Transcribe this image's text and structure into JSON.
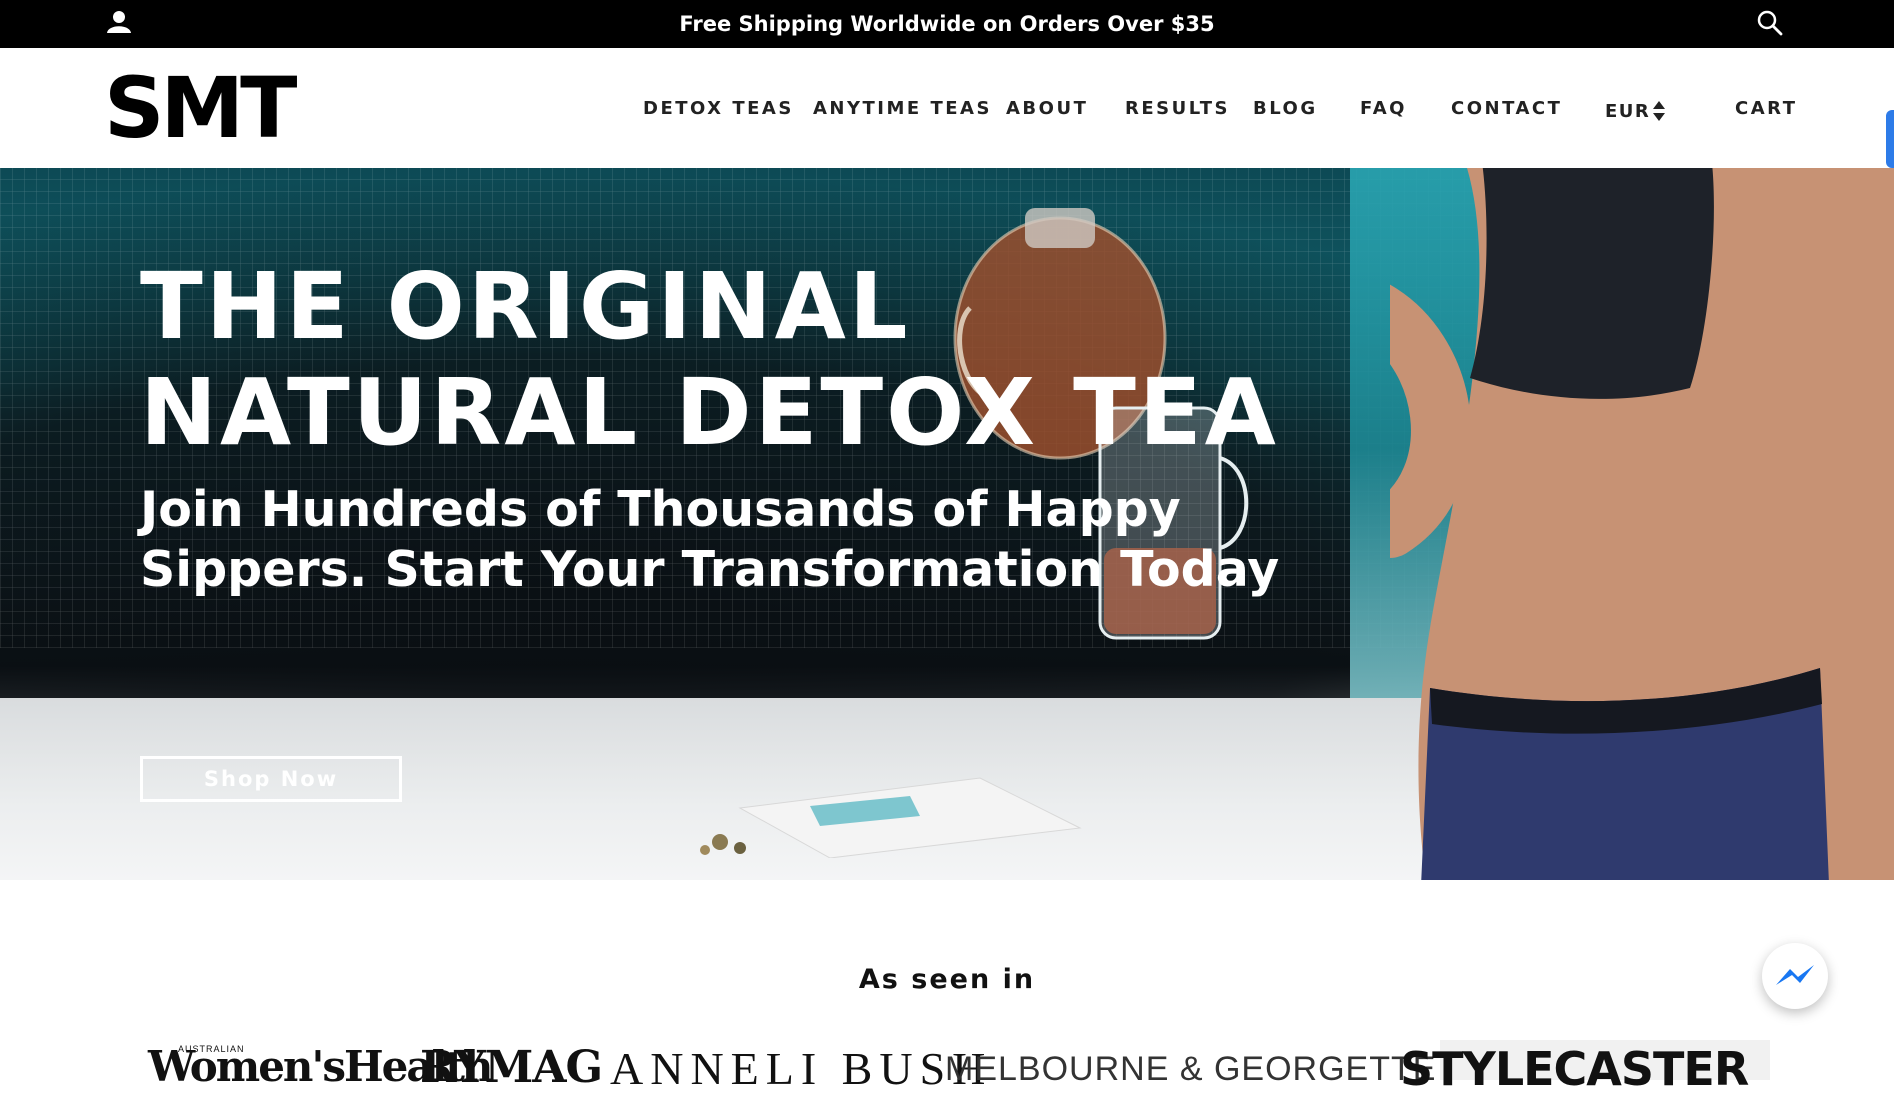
{
  "announcement": {
    "text": "Free Shipping Worldwide on Orders Over $35"
  },
  "header": {
    "logo": "SMT",
    "nav": [
      "DETOX TEAS",
      "ANYTIME TEAS",
      "ABOUT",
      "RESULTS",
      "BLOG",
      "FAQ",
      "CONTACT"
    ],
    "currency": "EUR",
    "cart": "CART"
  },
  "hero": {
    "title_line1": "THE ORIGINAL",
    "title_line2": "NATURAL DETOX TEA",
    "subtitle_line1": "Join Hundreds of Thousands of Happy",
    "subtitle_line2": "Sippers. Start Your Transformation Today",
    "cta": "Shop Now"
  },
  "press": {
    "title": "As seen in",
    "logos": [
      "Women'sHealth",
      "RYMAG",
      "ANNELI BUSH",
      "MELBOURNE & GEORGETTE",
      "STYLECASTER"
    ],
    "wh_prefix": "AUSTRALIAN"
  },
  "icons": {
    "account": "account-icon",
    "search": "search-icon",
    "currency_arrows": "sort-arrows-icon",
    "messenger": "messenger-icon"
  },
  "colors": {
    "announcement_bg": "#000000",
    "accent": "#2d7be8",
    "hero_text": "#ffffff"
  }
}
